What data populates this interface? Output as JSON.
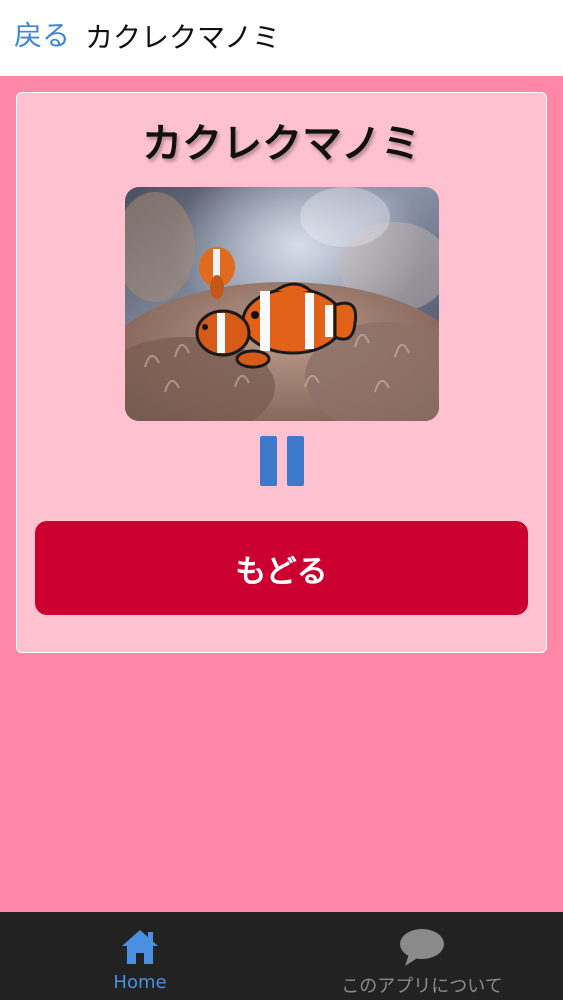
{
  "header": {
    "back_label": "戻る",
    "title": "カクレクマノミ"
  },
  "card": {
    "title": "カクレクマノミ",
    "photo_icon": "clownfish-photo",
    "pause_icon": "pause-icon",
    "back_button_label": "もどる"
  },
  "tabbar": {
    "tabs": [
      {
        "label": "Home",
        "icon": "home-icon",
        "active": true
      },
      {
        "label": "このアプリについて",
        "icon": "speech-bubble-icon",
        "active": false
      }
    ]
  },
  "colors": {
    "background": "#fe86a6",
    "card": "#fec1d0",
    "back_button": "#cc0030",
    "link": "#3b86d9",
    "tab_active": "#4a8fe0",
    "tab_inactive": "#8a8a8a",
    "tabbar": "#222222"
  }
}
